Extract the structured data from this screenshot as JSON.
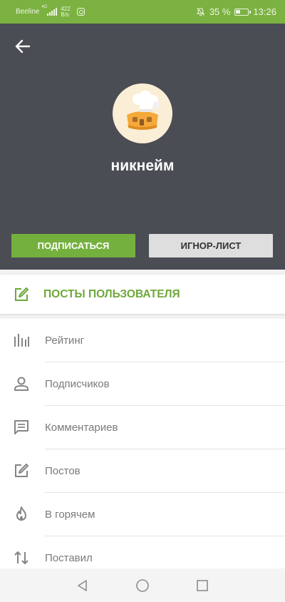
{
  "status_bar": {
    "carrier": "Beeline",
    "network": "4G",
    "speed_value": "422",
    "speed_unit": "B/s",
    "battery": "35 %",
    "time": "13:26"
  },
  "profile": {
    "nickname": "никнейм",
    "subscribe_label": "ПОДПИСАТЬСЯ",
    "ignore_label": "ИГНОР-ЛИСТ"
  },
  "posts_link": {
    "label": "ПОСТЫ ПОЛЬЗОВАТЕЛЯ"
  },
  "stats": [
    {
      "icon": "bar-chart-icon",
      "label": "Рейтинг"
    },
    {
      "icon": "person-icon",
      "label": "Подписчиков"
    },
    {
      "icon": "comment-icon",
      "label": "Комментариев"
    },
    {
      "icon": "edit-icon",
      "label": "Постов"
    },
    {
      "icon": "flame-icon",
      "label": "В горячем"
    },
    {
      "icon": "swap-arrows-icon",
      "label": "Поставил"
    }
  ],
  "colors": {
    "status_bar": "#7bb241",
    "header_bg": "#4a4d54",
    "accent_green": "#74b03e",
    "ignore_button": "#dedede"
  }
}
